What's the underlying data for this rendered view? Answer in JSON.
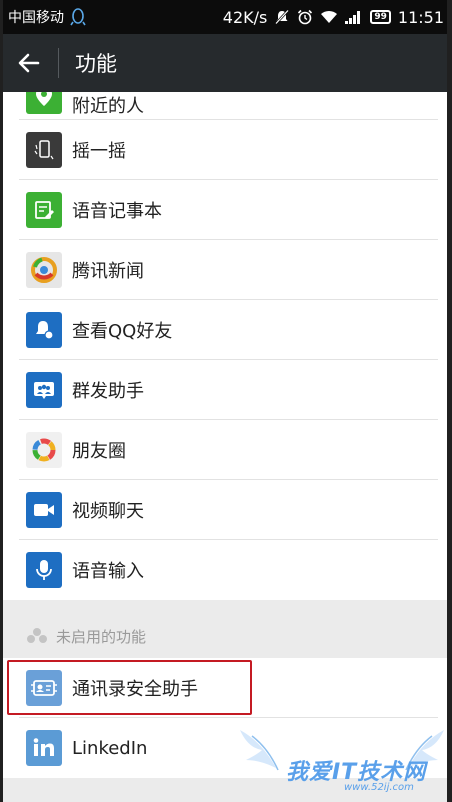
{
  "status_bar": {
    "carrier": "中国移动",
    "speed": "42K/s",
    "battery": "99",
    "time": "11:51"
  },
  "toolbar": {
    "title": "功能"
  },
  "features": [
    {
      "label": "附近的人",
      "icon": "location-pin-icon",
      "color": "#3cb034"
    },
    {
      "label": "摇一摇",
      "icon": "shake-phone-icon",
      "color": "#3a3a3a"
    },
    {
      "label": "语音记事本",
      "icon": "voice-notepad-icon",
      "color": "#3cb034"
    },
    {
      "label": "腾讯新闻",
      "icon": "tencent-news-icon",
      "color": "#e6e6e6"
    },
    {
      "label": "查看QQ好友",
      "icon": "qq-friends-icon",
      "color": "#1e6ec2"
    },
    {
      "label": "群发助手",
      "icon": "mass-send-icon",
      "color": "#1e6ec2"
    },
    {
      "label": "朋友圈",
      "icon": "moments-icon",
      "color": "#f0f0f0"
    },
    {
      "label": "视频聊天",
      "icon": "video-camera-icon",
      "color": "#1e6ec2"
    },
    {
      "label": "语音输入",
      "icon": "microphone-icon",
      "color": "#1e6ec2"
    }
  ],
  "disabled_section": {
    "title": "未启用的功能",
    "items": [
      {
        "label": "通讯录安全助手",
        "icon": "contacts-security-icon",
        "color": "#6aa0d8"
      },
      {
        "label": "LinkedIn",
        "icon": "linkedin-icon",
        "color": "#5b9bd5"
      }
    ]
  },
  "watermark": {
    "text": "我爱IT技术网",
    "url": "www.52ij.com"
  },
  "colors": {
    "status_bar": "#0c0c0c",
    "toolbar": "#262a2d",
    "section_bg": "#ebebeb",
    "highlight": "#c41a23"
  }
}
